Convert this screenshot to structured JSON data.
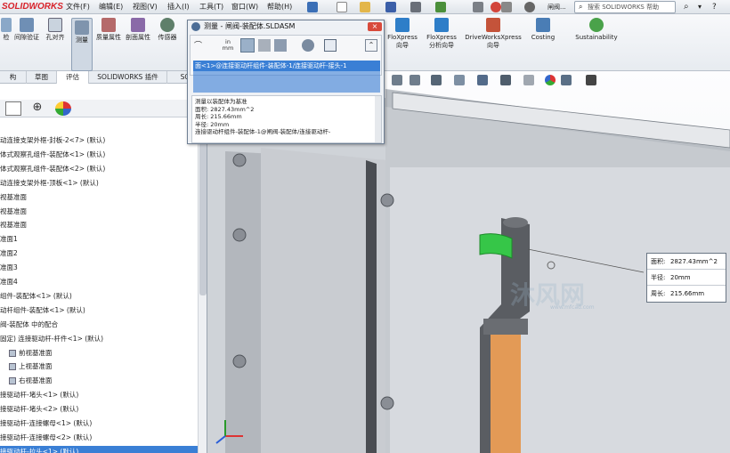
{
  "app": {
    "logo": "SOLIDWORKS"
  },
  "menu": [
    "文件(F)",
    "编辑(E)",
    "视图(V)",
    "插入(I)",
    "工具(T)",
    "窗口(W)",
    "帮助(H)"
  ],
  "quick_title": "闸阀...",
  "search": {
    "placeholder": "搜索 SOLIDWORKS 帮助"
  },
  "ribbon": {
    "commands": [
      "检",
      "间隙验证",
      "孔对齐",
      "测量",
      "质量属性",
      "剖面属性",
      "传感器",
      "FloXpress 向导",
      "FloXpress 分析向导",
      "DriveWorksXpress 向导",
      "Costing",
      "Sustainability"
    ]
  },
  "tabs": [
    "构",
    "草图",
    "评估",
    "SOLIDWORKS 插件",
    "SOL"
  ],
  "tree": [
    "动连接支架外框-封板-2<7> (默认)",
    "体式观察孔组件-装配体<1> (默认)",
    "体式观察孔组件-装配体<2> (默认)",
    "动连接支架外框-顶板<1> (默认)",
    "视基准面",
    "视基准面",
    "视基准面",
    "准面1",
    "准面2",
    "准面3",
    "准面4",
    "组件-装配体<1> (默认)",
    "动杆组件-装配体<1> (默认)",
    "阀-装配体 中的配合",
    "固定) 连接驱动杆-杆件<1> (默认)",
    "前视基准面",
    "上视基准面",
    "右视基准面",
    "接驱动杆-堵头<1> (默认)",
    "接驱动杆-堵头<2> (默认)",
    "接驱动杆-连接螺母<1> (默认)",
    "接驱动杆-连接螺母<2> (默认)",
    "接驱动杆-拉头<1> (默认)"
  ],
  "measure_dialog": {
    "title": "测量 - 闸阀-装配体.SLDASM",
    "close": "×",
    "unit_label": "in mm",
    "selection": "面<1>@连接驱动杆组件-装配体-1/连接驱动杆-接头-1",
    "result_lines": [
      "测量以装配体为基准",
      "面积: 2827.43mm^2",
      "周长: 215.66mm",
      "半径: 20mm",
      "连接驱动杆组件-装配体-1@闸阀-装配体/连接驱动杆-"
    ]
  },
  "callout": {
    "rows": [
      {
        "label": "面积:",
        "value": "2827.43mm^2"
      },
      {
        "label": "半径:",
        "value": "20mm"
      },
      {
        "label": "周长:",
        "value": "215.66mm"
      }
    ]
  },
  "watermark": "沐风网",
  "watermark_url": "www.mfcad.com",
  "colors": {
    "accent": "#3a7fd5",
    "brand_red": "#d8222a",
    "model_green": "#36c648",
    "model_orange": "#e79b58"
  }
}
